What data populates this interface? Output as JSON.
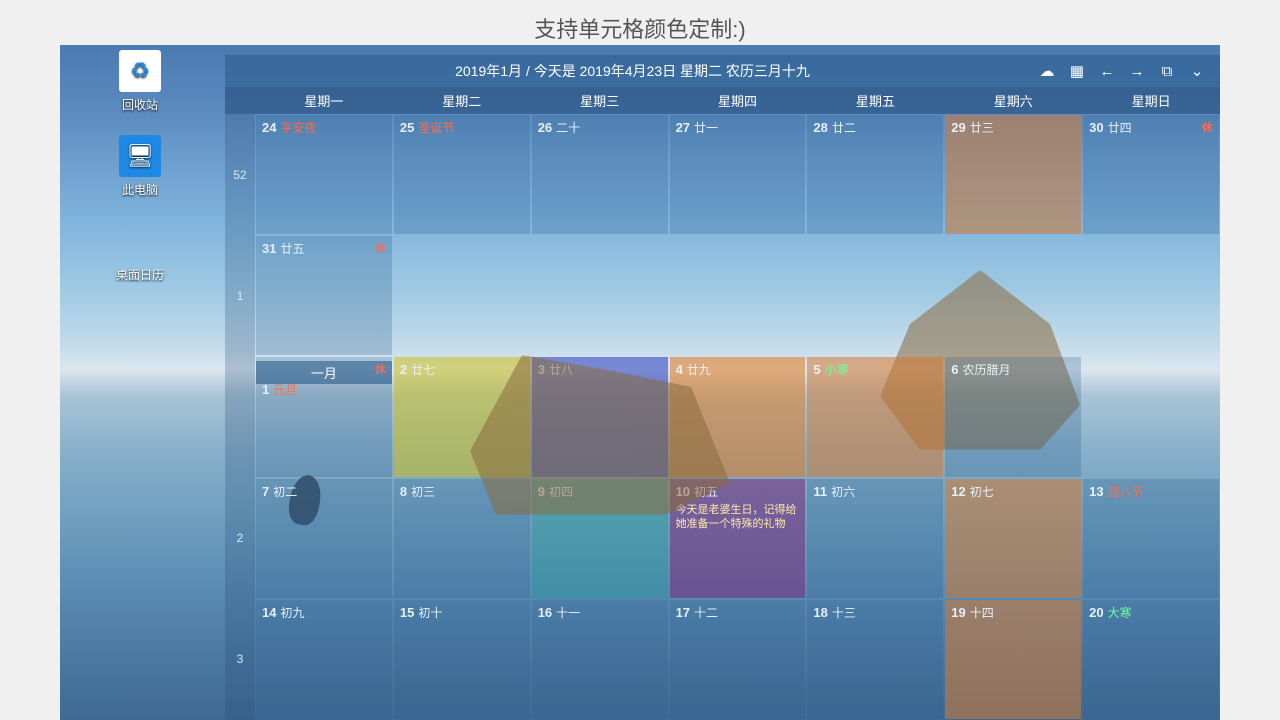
{
  "caption": "支持单元格颜色定制:)",
  "desktop_icons": {
    "recycle": "回收站",
    "pc": "此电脑",
    "calendar": "桌面日历"
  },
  "titlebar": {
    "text": "2019年1月 / 今天是 2019年4月23日 星期二 农历三月十九"
  },
  "daynames": [
    "星期一",
    "星期二",
    "星期三",
    "星期四",
    "星期五",
    "星期六",
    "星期日"
  ],
  "month_label": "一月",
  "weeks": [
    {
      "num": "52",
      "cells": [
        {
          "d": "24",
          "lu": "平安夜",
          "lured": true
        },
        {
          "d": "25",
          "lu": "圣诞节",
          "lured": true
        },
        {
          "d": "26",
          "lu": "二十"
        },
        {
          "d": "27",
          "lu": "廿一"
        },
        {
          "d": "28",
          "lu": "廿二"
        },
        {
          "d": "29",
          "lu": "廿三",
          "tint": "t-dorange"
        },
        {
          "d": "30",
          "lu": "廿四",
          "hol": "休"
        }
      ]
    },
    {
      "num": "1",
      "cells": [
        {
          "d": "31",
          "lu": "廿五",
          "hol": "休"
        },
        {
          "blank": true
        },
        {
          "blank": true
        },
        {
          "blank": true
        },
        {
          "blank": true
        },
        {
          "blank": true
        },
        {
          "blank": true
        }
      ]
    },
    {
      "num": "",
      "newmonth": true,
      "cells": [
        {
          "d": "1",
          "lu": "元旦",
          "lured": true,
          "hol": "休"
        },
        {
          "d": "2",
          "lu": "廿七",
          "tint": "t-yellow"
        },
        {
          "d": "3",
          "lu": "廿八",
          "tint": "t-blue"
        },
        {
          "d": "4",
          "lu": "廿九",
          "tint": "t-orange"
        },
        {
          "d": "5",
          "lu": "小寒",
          "lugreen": true,
          "tint": "t-dorange"
        },
        {
          "d": "6",
          "lu": "农历腊月"
        },
        {
          "blank": true
        }
      ]
    },
    {
      "num": "2",
      "cells": [
        {
          "d": "7",
          "lu": "初二"
        },
        {
          "d": "8",
          "lu": "初三"
        },
        {
          "d": "9",
          "lu": "初四",
          "tint": "t-teal"
        },
        {
          "d": "10",
          "lu": "初五",
          "tint": "t-purple",
          "note": "今天是老婆生日，记得给她准备一个特殊的礼物"
        },
        {
          "d": "11",
          "lu": "初六"
        },
        {
          "d": "12",
          "lu": "初七",
          "tint": "t-dorange"
        },
        {
          "d": "13",
          "lu": "腊八节",
          "lured": true
        }
      ]
    },
    {
      "num": "3",
      "cells": [
        {
          "d": "14",
          "lu": "初九"
        },
        {
          "d": "15",
          "lu": "初十"
        },
        {
          "d": "16",
          "lu": "十一"
        },
        {
          "d": "17",
          "lu": "十二"
        },
        {
          "d": "18",
          "lu": "十三"
        },
        {
          "d": "19",
          "lu": "十四",
          "tint": "t-dorange"
        },
        {
          "d": "20",
          "lu": "大寒",
          "lugreen": true
        }
      ]
    }
  ]
}
